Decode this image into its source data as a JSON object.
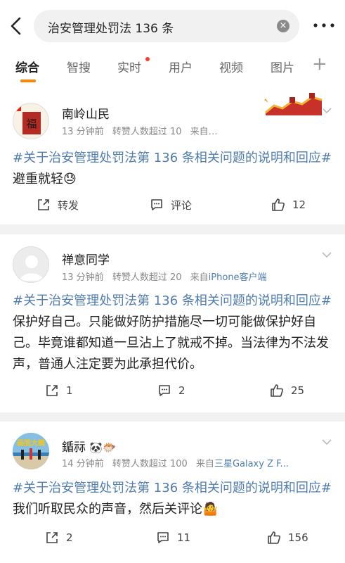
{
  "search": {
    "query": "治安管理处罚法 136 条"
  },
  "tabs": [
    {
      "label": "综合"
    },
    {
      "label": "智搜"
    },
    {
      "label": "实时"
    },
    {
      "label": "用户"
    },
    {
      "label": "视频"
    },
    {
      "label": "图片"
    }
  ],
  "colors": {
    "accent": "#ff8200",
    "link": "#507daf",
    "red_dot": "#ff3b30"
  },
  "posts": [
    {
      "user": "南岭山民",
      "time": "13 分钟前",
      "repost_note": "转赞人数超过 10",
      "source_prefix": "来自…",
      "source": "",
      "tag": "#关于治安管理处罚法第 136 条相关问题的说明和回应#",
      "text": "避重就轻",
      "emoji": "😓",
      "repost": "转发",
      "comment": "评论",
      "like": "12"
    },
    {
      "user": "禅意同学",
      "time": "13 分钟前",
      "repost_note": "转赞人数超过 20",
      "source_prefix": "来自",
      "source": "iPhone客户端",
      "tag": "#关于治安管理处罚法第 136 条相关问题的说明和回应#",
      "text": "保护好自己。只能做好防护措施尽一切可能做保护好自己。毕竟谁都知道一旦沾上了就戒不掉。当法律为不法发声，普通人注定要为此承担代价。",
      "emoji": "",
      "repost": "1",
      "comment": "2",
      "like": "25"
    },
    {
      "user": "鍎祘",
      "user_emojis": "🐼🐡",
      "time": "14 分钟前",
      "repost_note": "转赞人数超过 100",
      "source_prefix": "来自",
      "source": "三星Galaxy Z F...",
      "tag": "#关于治安管理处罚法第 136 条相关问题的说明和回应#",
      "text": "我们听取民众的声音，然后关评论",
      "emoji": "🤷",
      "repost": "2",
      "comment": "11",
      "like": "156"
    }
  ]
}
